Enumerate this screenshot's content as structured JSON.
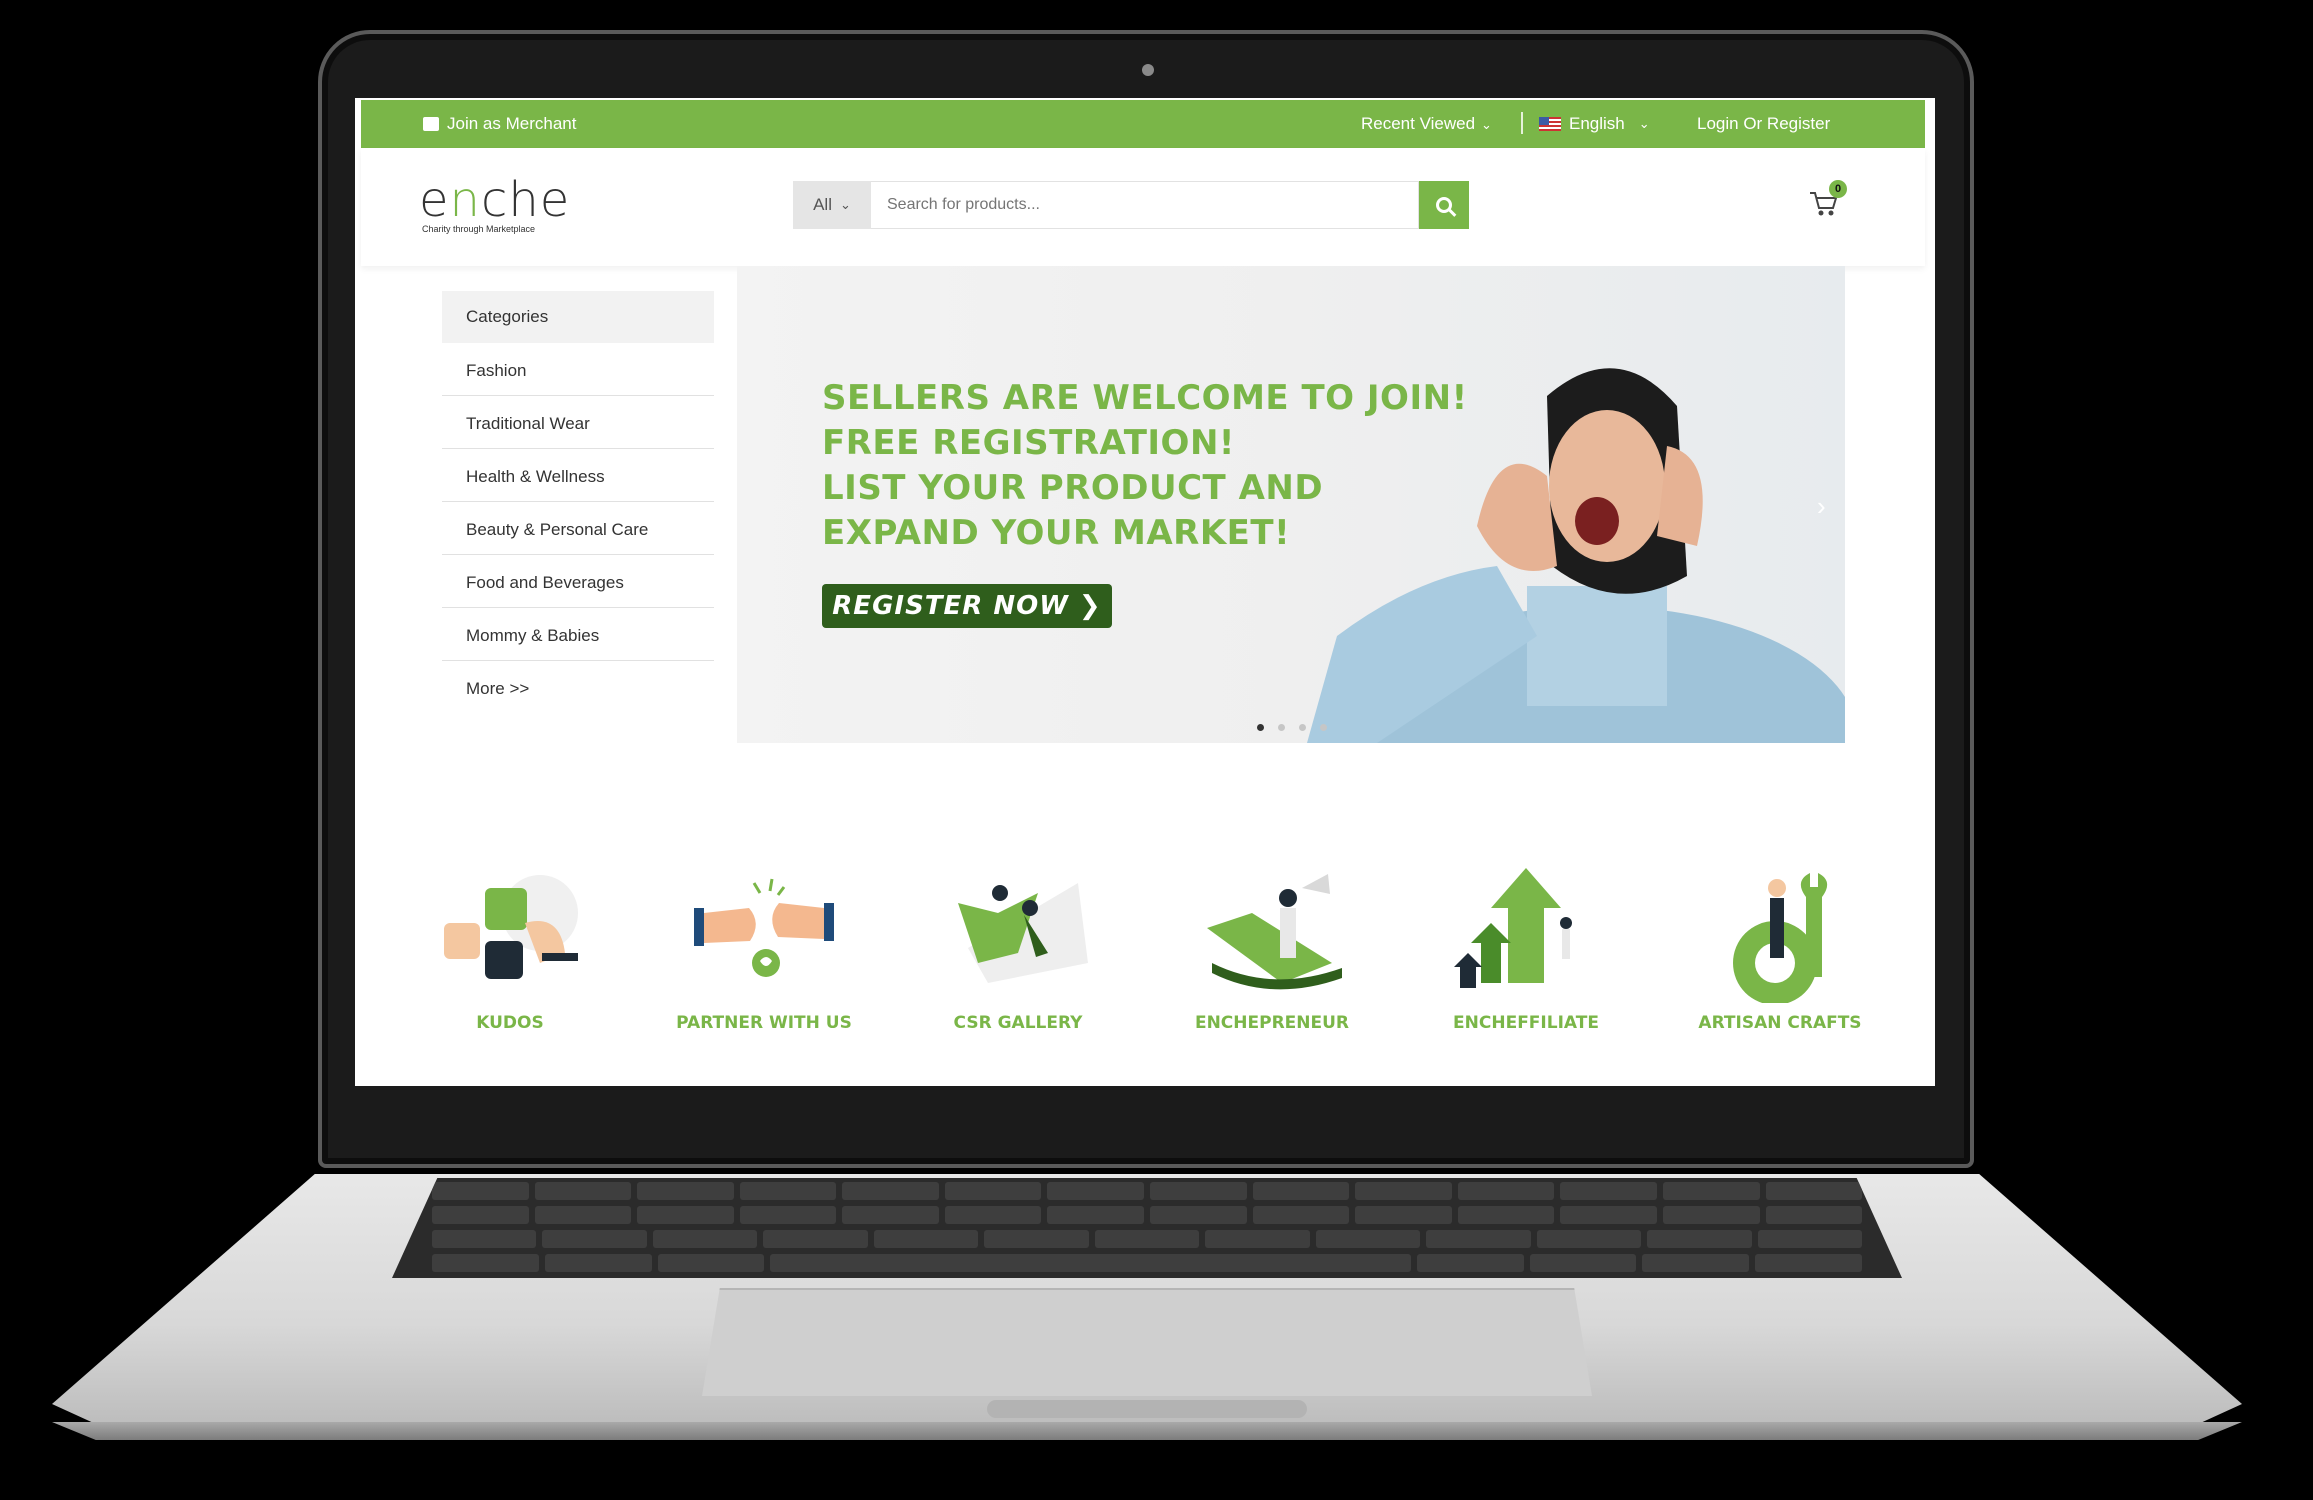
{
  "topbar": {
    "merchant_label": "Join as Merchant",
    "recent_label": "Recent Viewed",
    "language_label": "English",
    "login_label": "Login Or Register"
  },
  "header": {
    "logo_prefix": "e",
    "logo_accent": "n",
    "logo_suffix": "che",
    "logo_tagline": "Charity through Marketplace",
    "search_category": "All",
    "search_placeholder": "Search for products...",
    "cart_count": "0"
  },
  "categories": {
    "heading": "Categories",
    "items": [
      "Fashion",
      "Traditional Wear",
      "Health & Wellness",
      "Beauty & Personal Care",
      "Food and Beverages",
      "Mommy & Babies",
      "More >>"
    ]
  },
  "banner": {
    "lines": [
      "SELLERS ARE WELCOME TO JOIN!",
      "FREE REGISTRATION!",
      "LIST YOUR PRODUCT AND",
      "EXPAND YOUR MARKET!"
    ],
    "cta_label": "REGISTER NOW",
    "slide_count": 4,
    "active_slide": 1
  },
  "features": [
    {
      "label": "KUDOS",
      "icon": "kudos-icon"
    },
    {
      "label": "PARTNER WITH US",
      "icon": "partner-icon"
    },
    {
      "label": "CSR GALLERY",
      "icon": "csr-gallery-icon"
    },
    {
      "label": "ENCHEPRENEUR",
      "icon": "enchepreneur-icon"
    },
    {
      "label": "ENCHEFFILIATE",
      "icon": "encheffiliate-icon"
    },
    {
      "label": "ARTISAN CRAFTS",
      "icon": "artisan-crafts-icon"
    }
  ],
  "colors": {
    "brand_green": "#7ab648",
    "cta_dark_green": "#2f5e1c"
  }
}
